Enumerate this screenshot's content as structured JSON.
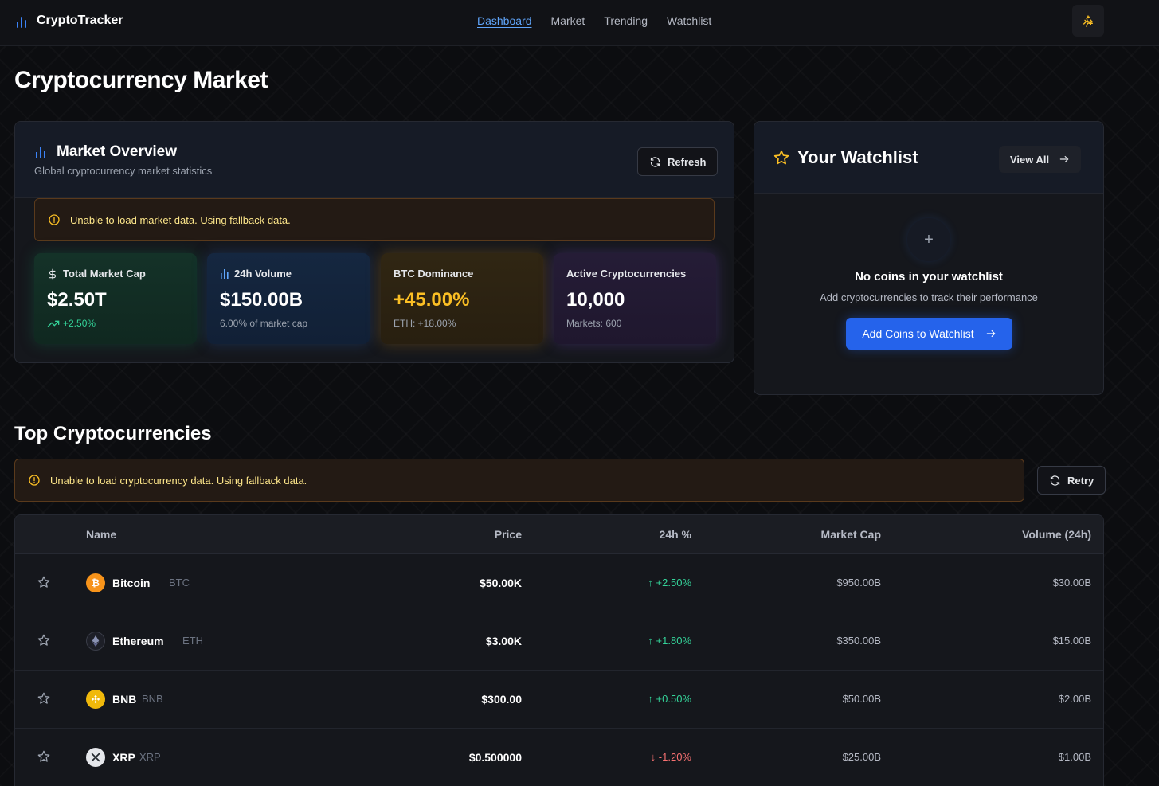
{
  "app": {
    "name": "CryptoTracker"
  },
  "nav": {
    "items": [
      "Dashboard",
      "Market",
      "Trending",
      "Watchlist"
    ],
    "active": "Dashboard"
  },
  "page": {
    "title": "Cryptocurrency Market"
  },
  "overview": {
    "title": "Market Overview",
    "subtitle": "Global cryptocurrency market statistics",
    "refresh_label": "Refresh",
    "alert": "Unable to load market data. Using fallback data.",
    "stats": [
      {
        "label": "Total Market Cap",
        "value": "$2.50T",
        "sub": "+2.50%",
        "icon": "dollar-icon"
      },
      {
        "label": "24h Volume",
        "value": "$150.00B",
        "sub": "6.00% of market cap",
        "icon": "bar-chart-icon"
      },
      {
        "label": "BTC Dominance",
        "value": "+45.00%",
        "sub": "ETH: +18.00%"
      },
      {
        "label": "Active Cryptocurrencies",
        "value": "10,000",
        "sub": "Markets: 600"
      }
    ]
  },
  "watchlist": {
    "title": "Your Watchlist",
    "view_all": "View All",
    "empty_title": "No coins in your watchlist",
    "empty_sub": "Add cryptocurrencies to track their performance",
    "add_label": "Add Coins to Watchlist"
  },
  "top": {
    "title": "Top Cryptocurrencies",
    "alert": "Unable to load cryptocurrency data. Using fallback data.",
    "retry_label": "Retry",
    "columns": {
      "name": "Name",
      "price": "Price",
      "change": "24h %",
      "mcap": "Market Cap",
      "volume": "Volume (24h)"
    },
    "rows": [
      {
        "name": "Bitcoin",
        "symbol": "BTC",
        "price": "$50.00K",
        "change": "+2.50%",
        "dir": "up",
        "mcap": "$950.00B",
        "volume": "$30.00B"
      },
      {
        "name": "Ethereum",
        "symbol": "ETH",
        "price": "$3.00K",
        "change": "+1.80%",
        "dir": "up",
        "mcap": "$350.00B",
        "volume": "$15.00B"
      },
      {
        "name": "BNB",
        "symbol": "BNB",
        "price": "$300.00",
        "change": "+0.50%",
        "dir": "up",
        "mcap": "$50.00B",
        "volume": "$2.00B"
      },
      {
        "name": "XRP",
        "symbol": "XRP",
        "price": "$0.500000",
        "change": "-1.20%",
        "dir": "down",
        "mcap": "$25.00B",
        "volume": "$1.00B"
      }
    ]
  },
  "colors": {
    "accent": "#2563eb",
    "up": "#34d399",
    "down": "#f87171",
    "btc_dominance": "#fbbf24",
    "warning": "#fde68a"
  }
}
